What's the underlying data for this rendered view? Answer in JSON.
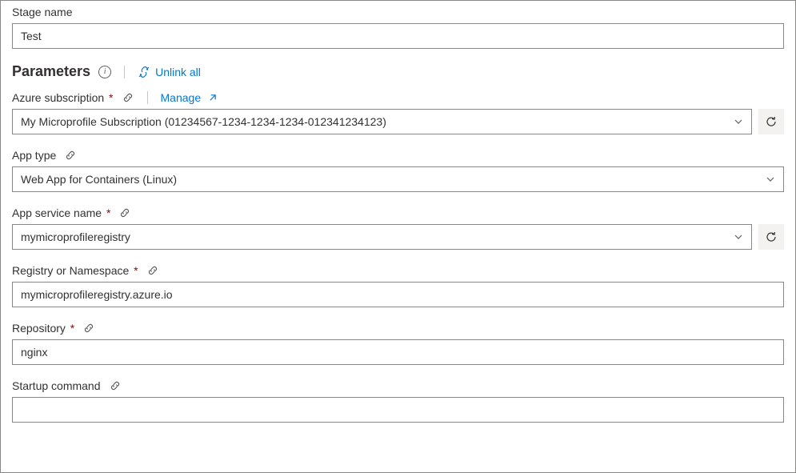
{
  "stage": {
    "label": "Stage name",
    "value": "Test"
  },
  "parameters": {
    "title": "Parameters",
    "unlink_all": "Unlink all"
  },
  "azure_subscription": {
    "label": "Azure subscription",
    "manage": "Manage",
    "value": "My Microprofile Subscription (01234567-1234-1234-1234-012341234123)"
  },
  "app_type": {
    "label": "App type",
    "value": "Web App for Containers (Linux)"
  },
  "app_service_name": {
    "label": "App service name",
    "value": "mymicroprofileregistry"
  },
  "registry_namespace": {
    "label": "Registry or Namespace",
    "value": "mymicroprofileregistry.azure.io"
  },
  "repository": {
    "label": "Repository",
    "value": "nginx"
  },
  "startup_command": {
    "label": "Startup command",
    "value": ""
  }
}
